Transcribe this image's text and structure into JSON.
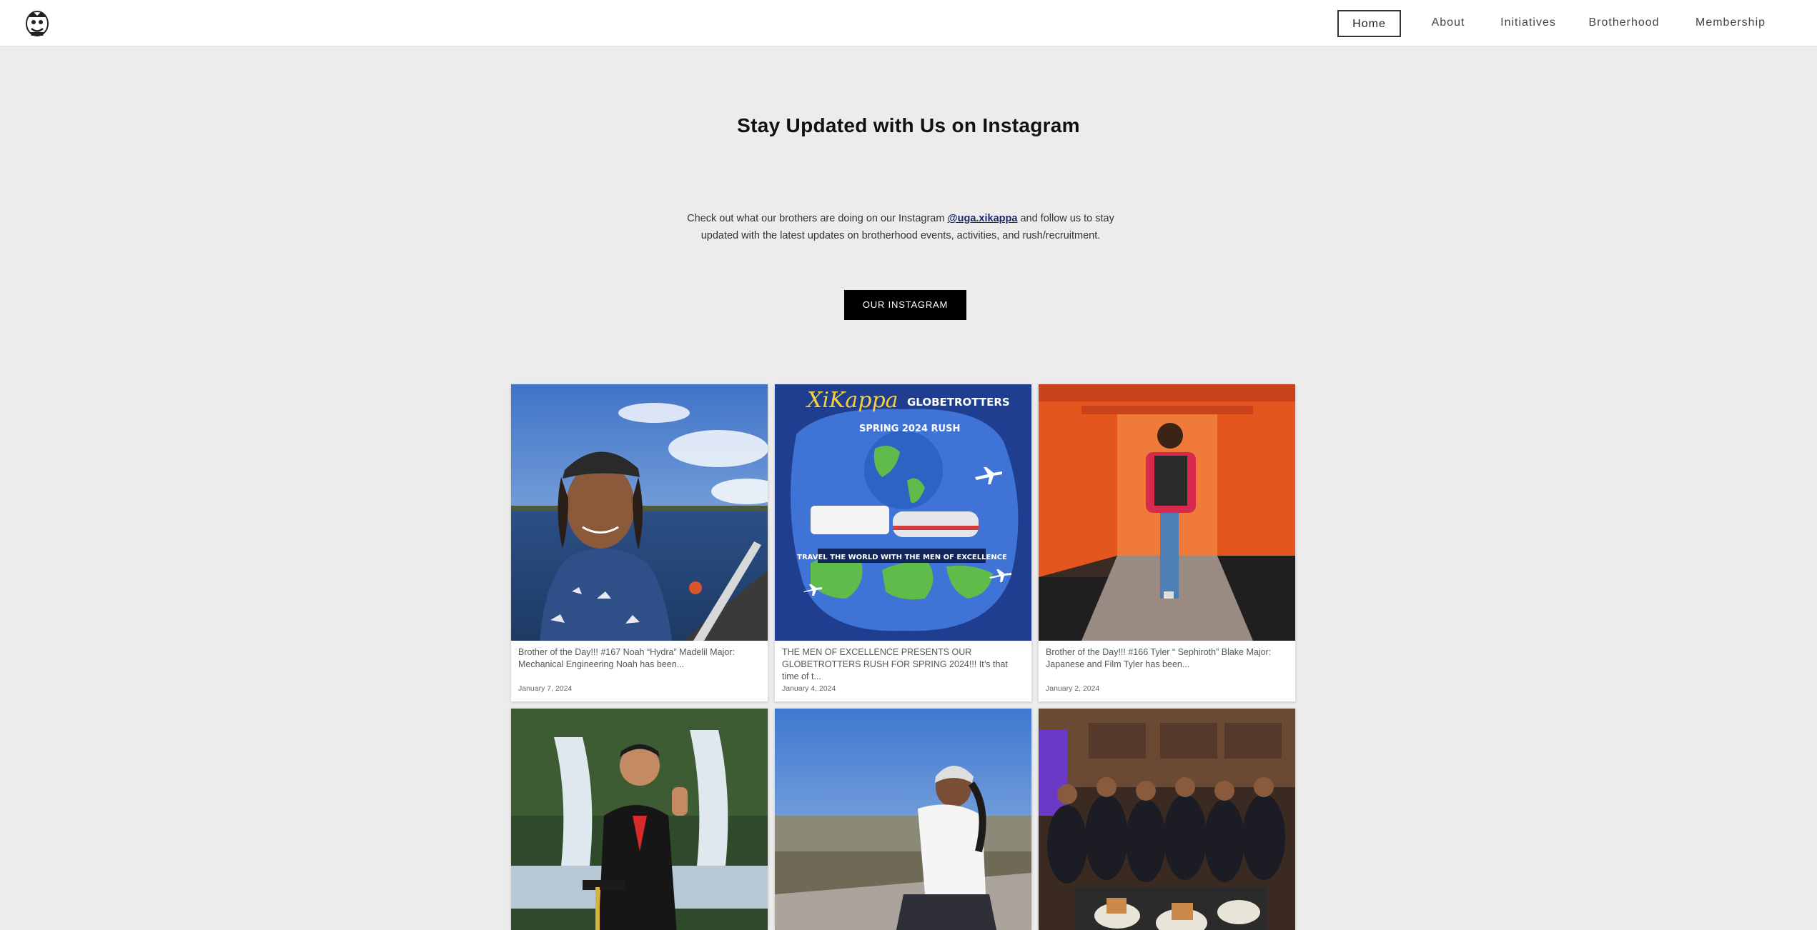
{
  "nav": {
    "items": [
      {
        "label": "Home",
        "active": true
      },
      {
        "label": "About",
        "active": false
      },
      {
        "label": "Initiatives",
        "active": false
      },
      {
        "label": "Brotherhood",
        "active": false
      },
      {
        "label": "Membership",
        "active": false
      }
    ]
  },
  "main": {
    "title": "Stay Updated with Us on Instagram",
    "intro_before": "Check out what our brothers are doing on our Instagram ",
    "intro_handle": "@uga.xikappa",
    "intro_after": " and follow us to stay updated with the latest updates on brotherhood events, activities, and rush/recruitment.",
    "cta_label": "OUR INSTAGRAM"
  },
  "posts": [
    {
      "caption": "Brother of the Day!!! #167 Noah “Hydra” Madelil Major: Mechanical Engineering Noah has been...",
      "date": "January 7, 2024"
    },
    {
      "caption": "THE MEN OF EXCELLENCE PRESENTS OUR GLOBETROTTERS RUSH FOR SPRING 2024!!! It’s that time of t...",
      "date": "January 4, 2024",
      "graphic": {
        "brand": "XiKappa",
        "line1": "GLOBETROTTERS",
        "line2": "SPRING 2024 RUSH",
        "banner": "TRAVEL THE WORLD WITH THE MEN OF EXCELLENCE"
      }
    },
    {
      "caption": "Brother of the Day!!! #166 Tyler “ Sephiroth” Blake Major: Japanese and Film Tyler has been...",
      "date": "January 2, 2024"
    },
    {
      "caption": "",
      "date": ""
    },
    {
      "caption": "",
      "date": ""
    },
    {
      "caption": "",
      "date": ""
    }
  ],
  "colors": {
    "accent": "#000000",
    "link": "#1b2a6b",
    "background": "#ececec"
  }
}
